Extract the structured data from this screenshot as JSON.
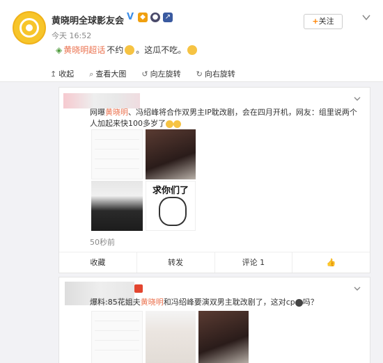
{
  "header": {
    "name": "黄晓明全球影友会",
    "time": "今天 16:52",
    "follow_label": "关注",
    "follow_plus": "+"
  },
  "post": {
    "topic": "黄晓明超话",
    "text": " 不约",
    "text2": "。这瓜不吃。"
  },
  "actions": [
    {
      "icon": "collect-icon",
      "label": "收起"
    },
    {
      "icon": "zoom-icon",
      "label": "查看大图"
    },
    {
      "icon": "rotate-left-icon",
      "label": "向左旋转"
    },
    {
      "icon": "rotate-right-icon",
      "label": "向右旋转"
    }
  ],
  "card1": {
    "text_pre": "网曝",
    "text_hl": "黄晓明",
    "text_post": "、冯绍峰将合作双男主IP耽改剧，会在四月开机，网友：组里说两个人加起来快100多岁了",
    "meme_text": "求你们了",
    "timestamp": "50秒前",
    "bar": [
      "收藏",
      "转发",
      "评论 1",
      ""
    ]
  },
  "card2": {
    "text_pre": "爆料:85花姐夫",
    "text_hl": "黄晓明",
    "text_post": "和冯绍峰要演双男主耽改剧了，这对cp",
    "text_end": "吗？"
  },
  "colors": {
    "accent": "#eb7350",
    "follow_plus": "#ff8200",
    "verified": "#3d8ee8"
  }
}
